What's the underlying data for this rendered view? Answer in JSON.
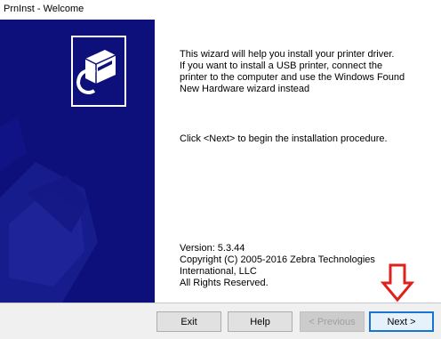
{
  "window": {
    "title": "PrnInst - Welcome"
  },
  "content": {
    "intro_lines": [
      "This wizard will help you install your printer driver.",
      "If you want to install a USB printer, connect the",
      "printer to the computer and use the Windows Found",
      "New Hardware wizard instead"
    ],
    "instruction": "Click <Next> to begin the installation procedure.",
    "version": "Version: 5.3.44",
    "copyright_lines": [
      "Copyright (C) 2005-2016 Zebra Technologies",
      "International, LLC",
      "All Rights Reserved."
    ]
  },
  "buttons": {
    "exit": "Exit",
    "help": "Help",
    "previous": "< Previous",
    "next": "Next >"
  },
  "colors": {
    "side_panel": "#0d0f7a",
    "annotation_arrow": "#e0201c",
    "default_button_border": "#1874d2"
  },
  "icons": {
    "installer_logo": "printer-install-icon",
    "annotation": "down-arrow-icon"
  }
}
